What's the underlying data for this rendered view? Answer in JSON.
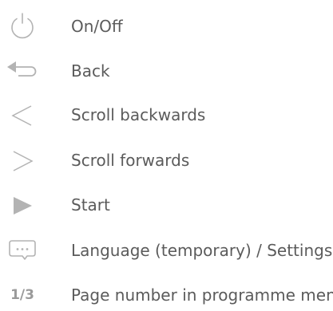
{
  "legend": {
    "items": [
      {
        "icon": "power-icon",
        "label": "On/Off"
      },
      {
        "icon": "back-arrow-icon",
        "label": "Back"
      },
      {
        "icon": "chevron-left-icon",
        "label": "Scroll backwards"
      },
      {
        "icon": "chevron-right-icon",
        "label": "Scroll forwards"
      },
      {
        "icon": "play-icon",
        "label": "Start"
      },
      {
        "icon": "speech-bubble-icon",
        "label": "Language (temporary) / Settings"
      },
      {
        "icon": "page-number-icon",
        "label": "Page number in programme menu",
        "icon_text": "1/3"
      }
    ]
  },
  "colors": {
    "icon": "#b3b3b3",
    "text": "#5b5b5b",
    "page_number": "#9a9a9a"
  }
}
